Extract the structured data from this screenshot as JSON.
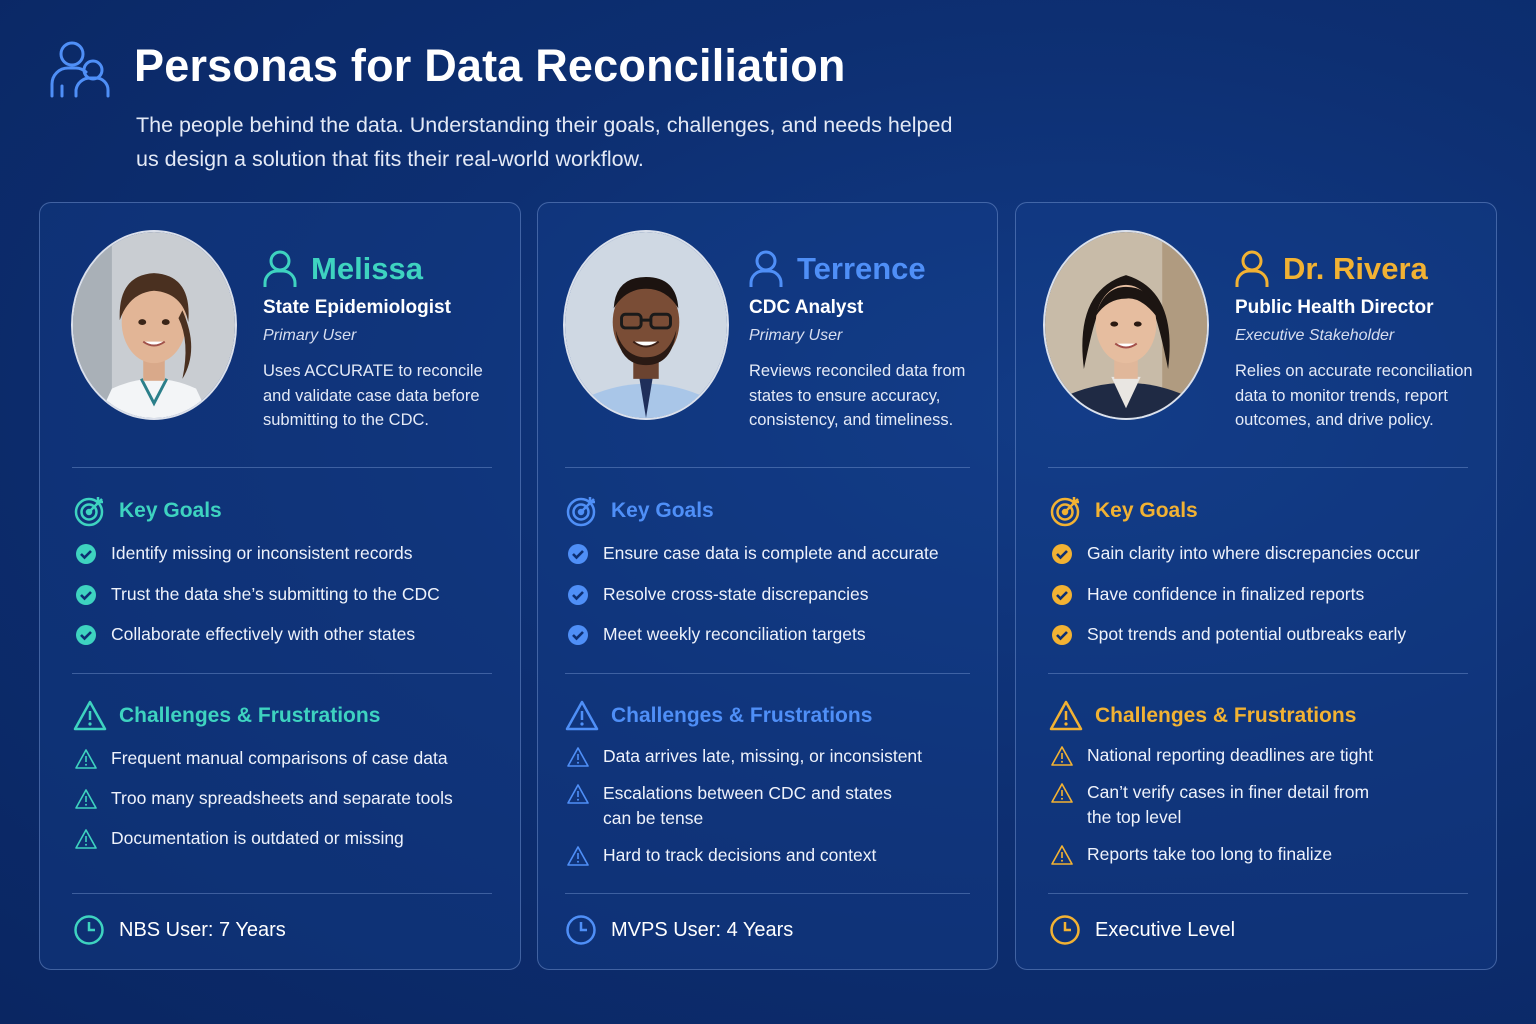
{
  "header": {
    "icon": "users-icon",
    "title": "Personas for Data Reconciliation",
    "subtitle": "The people behind the data. Understanding their goals, challenges, and needs helped us design a solution that fits their real-world workflow."
  },
  "colors": {
    "teal": "#3ed3c0",
    "blue": "#4f8ff7",
    "gold": "#f2b233",
    "background": "#0d2f72"
  },
  "personas": [
    {
      "name": "Melissa",
      "role": "State Epidemiologist",
      "level": "Primary User",
      "description": "Uses ACCURATE to reconcile and validate case data before submitting to the CDC.",
      "goals_title": "Key Goals",
      "goals": [
        "Identify missing or inconsistent records",
        "Trust the data she’s submitting to the CDC",
        "Collaborate effectively with other states"
      ],
      "challenges_title": "Challenges & Frustrations",
      "challenges": [
        "Frequent manual comparisons of case data",
        "Troo many spreadsheets and separate tools",
        "Documentation is outdated or missing"
      ],
      "footer": "NBS User: 7 Years"
    },
    {
      "name": "Terrence",
      "role": "CDC Analyst",
      "level": "Primary User",
      "description": "Reviews reconciled data from states to ensure accuracy, consistency, and timeliness.",
      "goals_title": "Key Goals",
      "goals": [
        "Ensure case data is complete and accurate",
        "Resolve cross-state discrepancies",
        "Meet weekly reconciliation targets"
      ],
      "challenges_title": "Challenges & Frustrations",
      "challenges": [
        "Data arrives late, missing, or inconsistent",
        "Escalations between CDC and states can be tense",
        "Hard to track decisions and context"
      ],
      "footer": "MVPS User: 4 Years"
    },
    {
      "name": "Dr. Rivera",
      "role": "Public Health Director",
      "level": "Executive Stakeholder",
      "description": "Relies on accurate reconciliation data to monitor trends, report outcomes, and drive policy.",
      "goals_title": "Key Goals",
      "goals": [
        "Gain clarity into where discrepancies occur",
        "Have confidence in finalized reports",
        "Spot trends and potential outbreaks early"
      ],
      "challenges_title": "Challenges & Frustrations",
      "challenges": [
        "National reporting deadlines are tight",
        "Can’t verify cases in finer detail from the top level",
        "Reports take too long to finalize"
      ],
      "footer": "Executive Level"
    }
  ]
}
